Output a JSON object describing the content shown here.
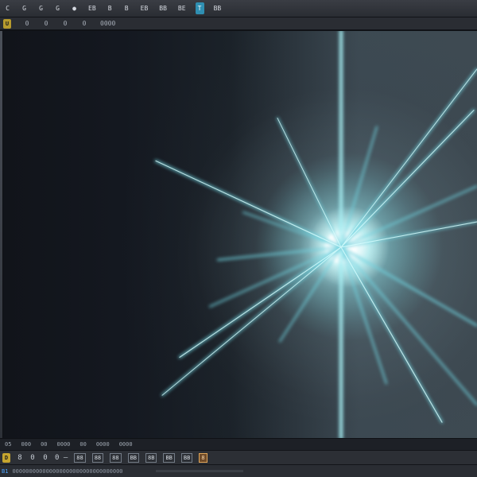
{
  "toolbar": {
    "buttons": [
      {
        "label": "C"
      },
      {
        "label": "G"
      },
      {
        "label": "G"
      },
      {
        "label": "G"
      },
      {
        "label": "●"
      },
      {
        "label": "EB"
      },
      {
        "label": "B"
      },
      {
        "label": "B"
      },
      {
        "label": "EB"
      },
      {
        "label": "BB"
      },
      {
        "label": "BE"
      },
      {
        "label": "T"
      },
      {
        "label": "BB"
      }
    ]
  },
  "subtoolbar": {
    "items": [
      {
        "label": "U"
      },
      {
        "label": "0"
      },
      {
        "label": "0"
      },
      {
        "label": "0"
      },
      {
        "label": "0"
      },
      {
        "label": "0000"
      }
    ]
  },
  "timeline": {
    "labels": [
      {
        "label": "05"
      },
      {
        "label": "000"
      },
      {
        "label": "00"
      },
      {
        "label": "0000"
      },
      {
        "label": "00"
      },
      {
        "label": "0000"
      },
      {
        "label": "0000"
      }
    ]
  },
  "bottom_toolbar": {
    "items": [
      {
        "label": "D"
      },
      {
        "label": "8"
      },
      {
        "label": "0"
      },
      {
        "label": "0"
      },
      {
        "label": "0 —"
      },
      {
        "label": "88"
      },
      {
        "label": "88"
      },
      {
        "label": "88"
      },
      {
        "label": "BB"
      },
      {
        "label": "8B"
      },
      {
        "label": "BB"
      },
      {
        "label": "BB"
      },
      {
        "label": "8"
      }
    ]
  },
  "status": {
    "left_chip": "B1",
    "text": "000000000000000000000000000000000"
  },
  "colors": {
    "accent": "#2f8fb2",
    "warning": "#c6a52e",
    "ray": "#68c8d7",
    "glow": "#d8ffff"
  }
}
